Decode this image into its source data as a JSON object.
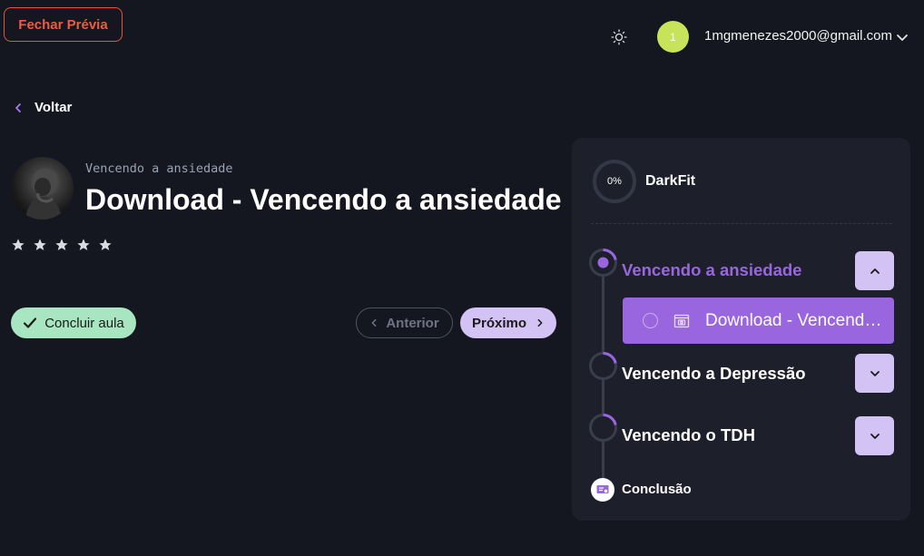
{
  "header": {
    "close_preview_label": "Fechar Prévia",
    "theme_icon": "sun-icon",
    "user": {
      "avatar_initial": "1",
      "avatar_color": "#c6e35a",
      "email": "1mgmenezes2000@gmail.com"
    }
  },
  "back_label": "Voltar",
  "lesson": {
    "course_subtitle": "Vencendo a ansiedade",
    "title": "Download - Vencendo a ansiedade",
    "rating_stars_total": 5,
    "rating_stars_filled": 0
  },
  "actions": {
    "complete_label": "Concluir aula",
    "previous_label": "Anterior",
    "next_label": "Próximo"
  },
  "sidebar": {
    "progress_text": "0%",
    "progress_value": 0,
    "course_name": "DarkFit",
    "modules": [
      {
        "title": "Vencendo a ansiedade",
        "expanded": true,
        "active": true,
        "lessons": [
          {
            "label": "Download - Vencendo a ansiedade",
            "active": true
          }
        ]
      },
      {
        "title": "Vencendo a Depressão",
        "expanded": false,
        "active": false
      },
      {
        "title": "Vencendo o TDH",
        "expanded": false,
        "active": false
      }
    ],
    "conclusion_label": "Conclusão"
  },
  "colors": {
    "background": "#151720",
    "panel": "#1d202b",
    "accent_purple": "#9a66e0",
    "accent_lilac": "#d3c3f4",
    "success_green": "#a7e6c0",
    "danger_orange": "#f05a3e"
  }
}
